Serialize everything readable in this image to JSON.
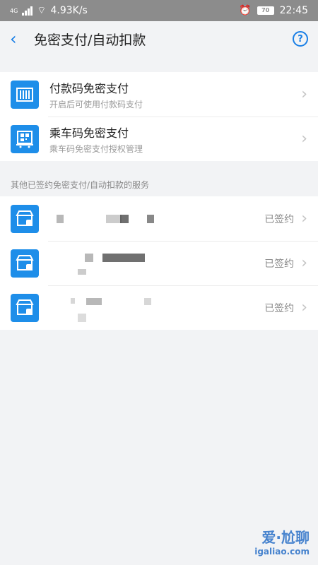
{
  "status_bar": {
    "network_speed": "4.93K/s",
    "network_label": "4G",
    "battery": "70",
    "time": "22:45"
  },
  "header": {
    "title": "免密支付/自动扣款",
    "help_symbol": "?"
  },
  "payment_items": [
    {
      "title": "付款码免密支付",
      "subtitle": "开启后可使用付款码支付",
      "icon": "barcode-icon"
    },
    {
      "title": "乘车码免密支付",
      "subtitle": "乘车码免密支付授权管理",
      "icon": "bus-code-icon"
    }
  ],
  "section_label": "其他已签约免密支付/自动扣款的服务",
  "services": [
    {
      "status": "已签约",
      "icon": "store-icon"
    },
    {
      "status": "已签约",
      "icon": "store-icon"
    },
    {
      "status": "已签约",
      "icon": "store-icon"
    }
  ],
  "watermark": {
    "line1": "爱·尬聊",
    "line2": "igaliao.com"
  },
  "colors": {
    "accent": "#1a7fe6",
    "icon_bg": "#1e8ee9"
  }
}
